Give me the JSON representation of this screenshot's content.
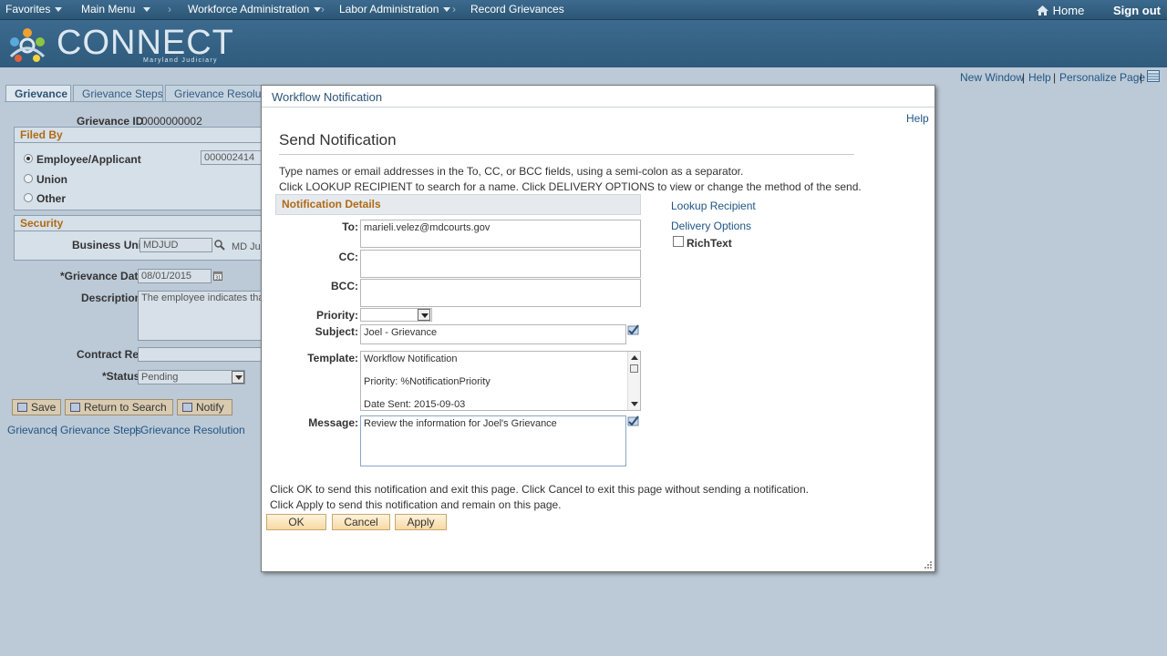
{
  "topnav": {
    "favorites": "Favorites",
    "main_menu": "Main Menu",
    "breadcrumb1": "Workforce Administration",
    "breadcrumb2": "Labor Administration",
    "breadcrumb3": "Record Grievances",
    "home": "Home",
    "signout": "Sign out"
  },
  "brand": {
    "name": "CONNECT",
    "sub": "Maryland Judiciary"
  },
  "pagelinks": {
    "new_window": "New Window",
    "help": "Help",
    "personalize": "Personalize Page"
  },
  "tabs": [
    "Grievance",
    "Grievance Steps",
    "Grievance Resolution"
  ],
  "form": {
    "grievance_id_label": "Grievance ID",
    "grievance_id": "0000000002",
    "filed_by_title": "Filed By",
    "radio_employee": "Employee/Applicant",
    "radio_union": "Union",
    "radio_other": "Other",
    "employee_id": "000002414",
    "security_title": "Security",
    "business_unit_label": "Business Unit",
    "business_unit": "MDJUD",
    "business_unit_desc": "MD Ju",
    "grievance_date_label": "*Grievance Date",
    "grievance_date": "08/01/2015",
    "description_label": "Description",
    "description": "The employee indicates tha",
    "contract_ref_label": "Contract Ref",
    "status_label": "*Status",
    "status": "Pending",
    "save": "Save",
    "return_search": "Return to Search",
    "notify": "Notify"
  },
  "bottomlinks": [
    "Grievance",
    "Grievance Steps",
    "Grievance Resolution"
  ],
  "modal": {
    "title": "Workflow Notification",
    "help": "Help",
    "heading": "Send Notification",
    "instr1": "Type names or email addresses in the To, CC, or BCC fields, using a semi-colon as a separator.",
    "instr2": "Click LOOKUP RECIPIENT to search for a name.  Click DELIVERY OPTIONS to view or change the method of the send.",
    "section_title": "Notification Details",
    "lookup": "Lookup Recipient",
    "delivery": "Delivery Options",
    "richtext": "RichText",
    "to_label": "To:",
    "to": "marieli.velez@mdcourts.gov",
    "cc_label": "CC:",
    "cc": "",
    "bcc_label": "BCC:",
    "bcc": "",
    "priority_label": "Priority:",
    "priority": "",
    "subject_label": "Subject:",
    "subject": "Joel - Grievance",
    "template_label": "Template:",
    "template_lines": [
      "Workflow Notification",
      "Priority:  %NotificationPriority",
      "Date Sent:  2015-09-03"
    ],
    "message_label": "Message:",
    "message": "Review the information for Joel's Grievance",
    "footer1": "Click OK to send this notification and exit this page.  Click Cancel to exit this page without sending a notification.",
    "footer2": "Click Apply to send this notification and remain on this page.",
    "ok": "OK",
    "cancel": "Cancel",
    "apply": "Apply"
  },
  "colors": {
    "nav": "#2f5b7c",
    "link": "#1f5584",
    "section": "#b06a16",
    "button": "#f7d9a3"
  }
}
